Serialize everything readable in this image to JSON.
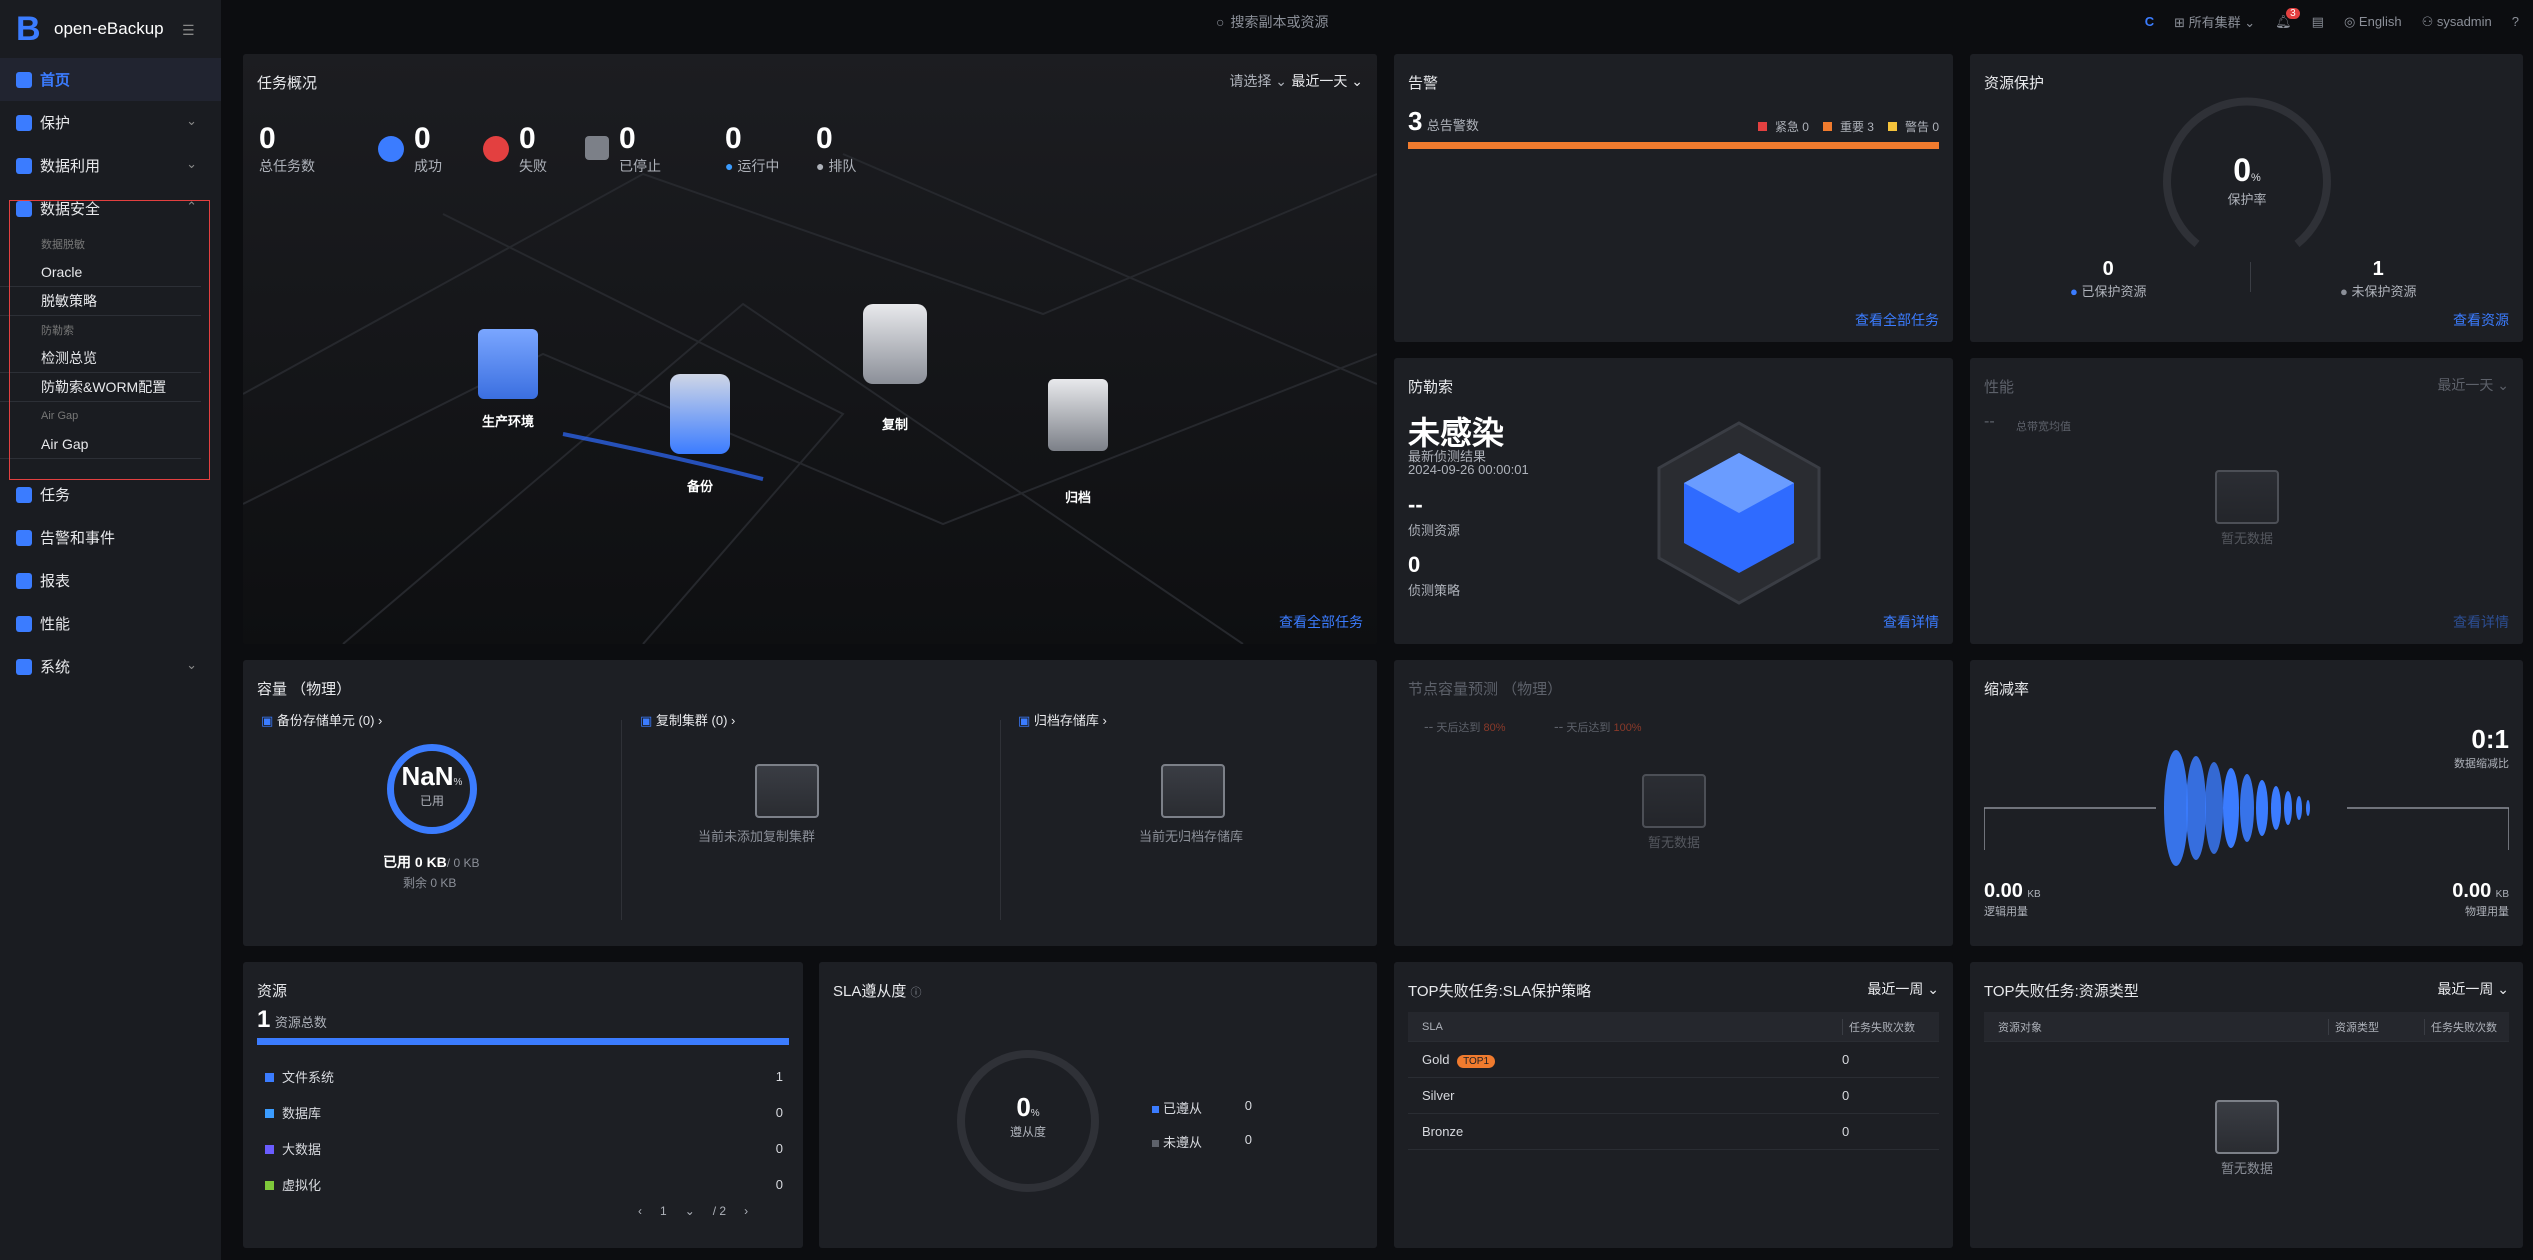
{
  "app": {
    "title": "open-eBackup",
    "logo": "B"
  },
  "sidebar": {
    "items": [
      {
        "label": "首页",
        "icon": "home-icon"
      },
      {
        "label": "保护",
        "icon": "protect-icon"
      },
      {
        "label": "数据利用",
        "icon": "data-use-icon"
      },
      {
        "label": "数据安全",
        "icon": "shield-icon"
      },
      {
        "label": "任务",
        "icon": "task-icon"
      },
      {
        "label": "告警和事件",
        "icon": "alarm-icon"
      },
      {
        "label": "报表",
        "icon": "report-icon"
      },
      {
        "label": "性能",
        "icon": "performance-icon"
      },
      {
        "label": "系统",
        "icon": "system-icon"
      }
    ],
    "sub_headers": [
      "数据脱敏",
      "防勒索",
      "Air Gap"
    ],
    "sub_items": [
      "Oracle",
      "脱敏策略",
      "检测总览",
      "防勒索&WORM配置",
      "Air Gap"
    ]
  },
  "topbar": {
    "search_placeholder": "搜索副本或资源",
    "cluster": "所有集群",
    "notification_count": "3",
    "language": "English",
    "user": "sysadmin",
    "help": "?"
  },
  "tasks": {
    "title": "任务概况",
    "select": "请选择",
    "range": "最近一天",
    "total": "0",
    "total_label": "总任务数",
    "success": "0",
    "success_label": "成功",
    "fail": "0",
    "fail_label": "失败",
    "stopped": "0",
    "stopped_label": "已停止",
    "running": "0",
    "running_label": "运行中",
    "queued": "0",
    "queued_label": "排队",
    "nodes": [
      "生产环境",
      "备份",
      "复制",
      "归档"
    ],
    "link": "查看全部任务"
  },
  "alarms": {
    "title": "告警",
    "total": "3",
    "total_label": "总告警数",
    "urgent": "紧急 0",
    "major": "重要 3",
    "warning": "警告 0",
    "link": "查看全部任务",
    "colors": {
      "urgent": "#e34040",
      "major": "#f07b2e",
      "warning": "#f5c33b"
    }
  },
  "protection": {
    "title": "资源保护",
    "rate": "0",
    "unit": "%",
    "rate_label": "保护率",
    "protected": "0",
    "protected_label": "已保护资源",
    "unprotected": "1",
    "unprotected_label": "未保护资源",
    "link": "查看资源"
  },
  "ransomware": {
    "title": "防勒索",
    "status": "未感染",
    "sub_label": "最新侦测结果",
    "time": "2024-09-26 00:00:01",
    "detected": "--",
    "detected_label": "侦测资源",
    "policies": "0",
    "policies_label": "侦测策略",
    "link": "查看详情"
  },
  "performance": {
    "title": "性能",
    "range": "最近一天",
    "value": "--",
    "value_label": "总带宽均值",
    "empty": "暂无数据",
    "link": "查看详情"
  },
  "capacity": {
    "title": "容量 （物理）",
    "backup_unit": "备份存储单元 (0)",
    "replica_cluster": "复制集群 (0)",
    "archive": "归档存储库",
    "percent": "NaN",
    "unit": "%",
    "used_label": "已用",
    "used_line": "已用 0 KB",
    "total": "/ 0 KB",
    "remaining": "剩余 0 KB",
    "replica_empty": "当前未添加复制集群",
    "archive_empty": "当前无归档存储库"
  },
  "forecast": {
    "title": "节点容量预测 （物理）",
    "a": "--",
    "a_label": "天后达到",
    "a_pct": "80%",
    "b": "--",
    "b_label": "天后达到",
    "b_pct": "100%",
    "empty": "暂无数据"
  },
  "reduction": {
    "title": "缩减率",
    "ratio": "0:1",
    "ratio_label": "数据缩减比",
    "logical": "0.00",
    "logical_unit": "KB",
    "logical_label": "逻辑用量",
    "physical": "0.00",
    "physical_unit": "KB",
    "physical_label": "物理用量"
  },
  "resources": {
    "title": "资源",
    "total": "1",
    "total_label": "资源总数",
    "rows": [
      {
        "label": "文件系统",
        "value": "1",
        "color": "#3b7cff"
      },
      {
        "label": "数据库",
        "value": "0",
        "color": "#3b9cff"
      },
      {
        "label": "大数据",
        "value": "0",
        "color": "#6a5cff"
      },
      {
        "label": "虚拟化",
        "value": "0",
        "color": "#7ec83a"
      }
    ],
    "page": "1",
    "pages": "/ 2"
  },
  "sla_compliance": {
    "title": "SLA遵从度",
    "rate": "0",
    "unit": "%",
    "rate_label": "遵从度",
    "complied": "已遵从",
    "complied_value": "0",
    "not_complied": "未遵从",
    "not_complied_value": "0"
  },
  "top_sla": {
    "title": "TOP失败任务:SLA保护策略",
    "range": "最近一周",
    "col1": "SLA",
    "col2": "任务失败次数",
    "rows": [
      {
        "name": "Gold",
        "tag": "TOP1",
        "count": "0"
      },
      {
        "name": "Silver",
        "tag": "",
        "count": "0"
      },
      {
        "name": "Bronze",
        "tag": "",
        "count": "0"
      }
    ]
  },
  "top_res": {
    "title": "TOP失败任务:资源类型",
    "range": "最近一周",
    "col1": "资源对象",
    "col2": "资源类型",
    "col3": "任务失败次数",
    "empty": "暂无数据"
  }
}
